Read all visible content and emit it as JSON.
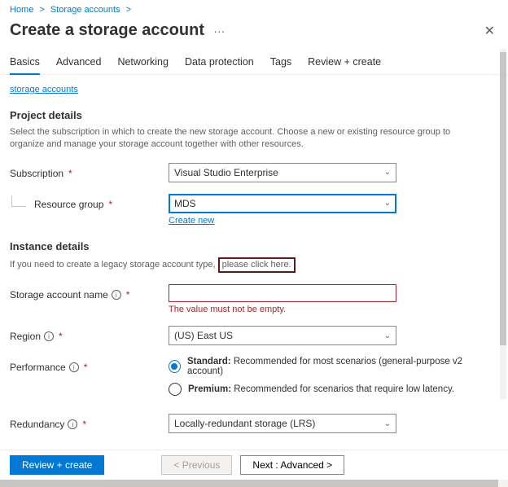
{
  "breadcrumb": {
    "home": "Home",
    "storage": "Storage accounts"
  },
  "page": {
    "title": "Create a storage account"
  },
  "tabs": [
    "Basics",
    "Advanced",
    "Networking",
    "Data protection",
    "Tags",
    "Review + create"
  ],
  "top_link": "storage accounts",
  "project": {
    "title": "Project details",
    "desc": "Select the subscription in which to create the new storage account. Choose a new or existing resource group to organize and manage your storage account together with other resources.",
    "subscription_label": "Subscription",
    "subscription_value": "Visual Studio Enterprise",
    "rg_label": "Resource group",
    "rg_value": "MDS",
    "create_new": "Create new"
  },
  "instance": {
    "title": "Instance details",
    "legacy_prefix": "If you need to create a legacy storage account type,",
    "legacy_box": " please click here.",
    "name_label": "Storage account name",
    "name_error": "The value must not be empty.",
    "region_label": "Region",
    "region_value": "(US) East US",
    "perf_label": "Performance",
    "perf_standard_label": "Standard:",
    "perf_standard_desc": " Recommended for most scenarios (general-purpose v2 account)",
    "perf_premium_label": "Premium:",
    "perf_premium_desc": " Recommended for scenarios that require low latency.",
    "redundancy_label": "Redundancy",
    "redundancy_value": "Locally-redundant storage (LRS)"
  },
  "footer": {
    "review": "Review + create",
    "prev": "< Previous",
    "next": "Next : Advanced >"
  }
}
